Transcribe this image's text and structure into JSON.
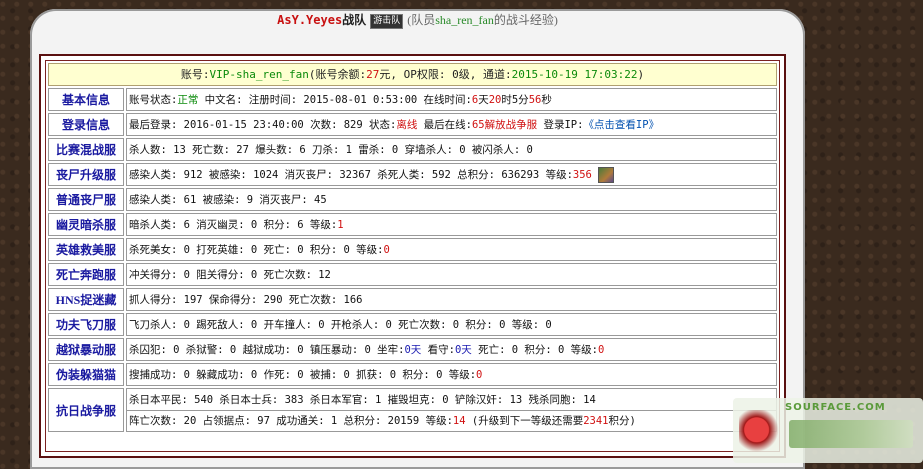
{
  "title": {
    "team": "AsY.Yeyes",
    "zhandui": "战队",
    "badge": "游击队",
    "prefix": "(队员",
    "username": "sha_ren_fan",
    "suffix": "的战斗经验)"
  },
  "account": {
    "l1": "账号:",
    "user": "VIP-sha_ren_fan",
    "l2": "(账号余额:",
    "balance": "27",
    "l3": "元, OP权限: 0级, 通道:",
    "date": "2015-10-19 17:03:22",
    "l4": ")"
  },
  "rows": {
    "basic": {
      "label": "基本信息",
      "a": "账号状态:",
      "status": "正常",
      "b": " 中文名:   注册时间: 2015-08-01 0:53:00 在线时间:",
      "days": "6",
      "c": "天",
      "hours": "20",
      "d": "时5分",
      "secs": "56",
      "e": "秒"
    },
    "login": {
      "label": "登录信息",
      "a": "最后登录: 2016-01-15 23:40:00 次数: 829 状态:",
      "state": "离线",
      "b": " 最后在线:",
      "server": "65解放战争服",
      "c": " 登录IP:",
      "ip": "《点击查看IP》"
    },
    "mix": {
      "label": "比赛混战服",
      "a": "杀人数: 13 死亡数: 27 爆头数: 6 刀杀: 1 雷杀: 0 穿墙杀人: 0 被闪杀人: 0"
    },
    "zombie_up": {
      "label": "丧尸升级服",
      "a": "感染人类: 912 被感染: 1024 消灭丧尸: 32367 杀死人类: 592 总积分: 636293 等级:",
      "level": "356"
    },
    "zombie": {
      "label": "普通丧尸服",
      "a": "感染人类: 61 被感染: 9 消灭丧尸: 45"
    },
    "ghost": {
      "label": "幽灵暗杀服",
      "a": "暗杀人类: 6 消灭幽灵: 0 积分: 6 等级:",
      "level": "1"
    },
    "hero": {
      "label": "英雄救美服",
      "a": "杀死美女: 0 打死英雄: 0 死亡: 0 积分: 0 等级:",
      "level": "0"
    },
    "death": {
      "label": "死亡奔跑服",
      "a": "冲关得分: 0 阻关得分: 0 死亡次数: 12"
    },
    "hns": {
      "label": "HNS捉迷藏",
      "a": "抓人得分: 197 保命得分: 290 死亡次数: 166"
    },
    "kungfu": {
      "label": "功夫飞刀服",
      "a": "飞刀杀人: 0 踢死敌人: 0 开车撞人: 0 开枪杀人: 0 死亡次数: 0 积分: 0 等级: 0"
    },
    "jail": {
      "label": "越狱暴动服",
      "a": "杀囚犯: 0 杀狱警: 0 越狱成功: 0 镇压暴动: 0 坐牢:",
      "jail_days": "0天",
      "b": " 看守:",
      "guard_days": "0天",
      "c": " 死亡: 0 积分: 0 等级:",
      "level": "0"
    },
    "hide": {
      "label": "伪装躲猫猫",
      "a": "搜捕成功: 0 躲藏成功: 0 作死: 0 被捕: 0 抓获: 0 积分: 0 等级:",
      "level": "0"
    },
    "war": {
      "label": "抗日战争服",
      "l1": "杀日本平民: 540 杀日本士兵: 383 杀日本军官: 1 摧毁坦克: 0 铲除汉奸: 13 残杀同胞: 14",
      "l2a": "阵亡次数: 20 占领据点: 97 成功通关: 1 总积分: 20159 等级:",
      "level": "14",
      "l2b": " (升级到下一等级还需要",
      "need": "2341",
      "l2c": "积分)"
    }
  },
  "watermark": {
    "text": "SOURFACE.COM"
  }
}
